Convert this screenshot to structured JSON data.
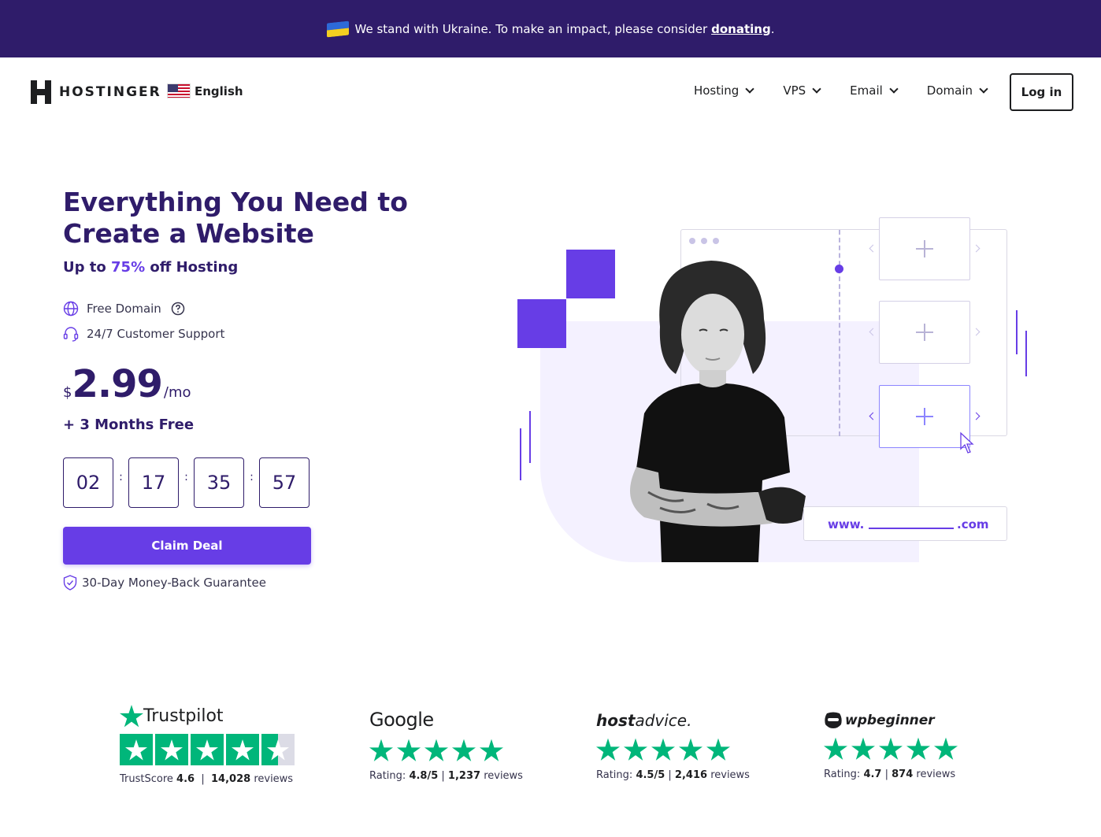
{
  "banner": {
    "text": "We stand with Ukraine. To make an impact, please consider",
    "link": "donating",
    "suffix": "."
  },
  "header": {
    "brand": "HOSTINGER",
    "language": "English",
    "nav": [
      "Hosting",
      "VPS",
      "Email",
      "Domain"
    ],
    "login": "Log in"
  },
  "hero": {
    "title": "Everything You Need to Create a Website",
    "subtitle_pre": "Up to ",
    "subtitle_highlight": "75%",
    "subtitle_post": " off Hosting",
    "features": [
      "Free Domain",
      "24/7 Customer Support"
    ],
    "price": {
      "currency": "$",
      "amount": "2.99",
      "period": "/mo"
    },
    "bonus": "+ 3 Months Free",
    "timer": [
      "02",
      "17",
      "35",
      "57"
    ],
    "timer_separator": ":",
    "cta": "Claim Deal",
    "guarantee": "30-Day Money-Back Guarantee"
  },
  "illustration": {
    "url_prefix": "www.",
    "url_suffix": ".com"
  },
  "reviews": {
    "trustpilot": {
      "brand": "Trustpilot",
      "label": "TrustScore",
      "score": "4.6",
      "sep": "|",
      "count": "14,028",
      "unit": "reviews",
      "stars_filled": 4.5
    },
    "google": {
      "brand": "Google",
      "label": "Rating:",
      "score": "4.8/5",
      "count": "1,237",
      "unit": "reviews",
      "stars": 5
    },
    "hostadvice": {
      "brand_bold": "host",
      "brand_rest": "advice.",
      "label": "Rating:",
      "score": "4.5/5",
      "count": "2,416",
      "unit": "reviews",
      "stars": 5
    },
    "wpbeginner": {
      "brand": "wpbeginner",
      "label": "Rating:",
      "score": "4.7",
      "count": "874",
      "unit": "reviews",
      "stars": 5
    }
  },
  "colors": {
    "brand_dark": "#2f1c6a",
    "accent": "#673de6",
    "banner": "#2f1c6a",
    "review_star": "#00b67a"
  }
}
